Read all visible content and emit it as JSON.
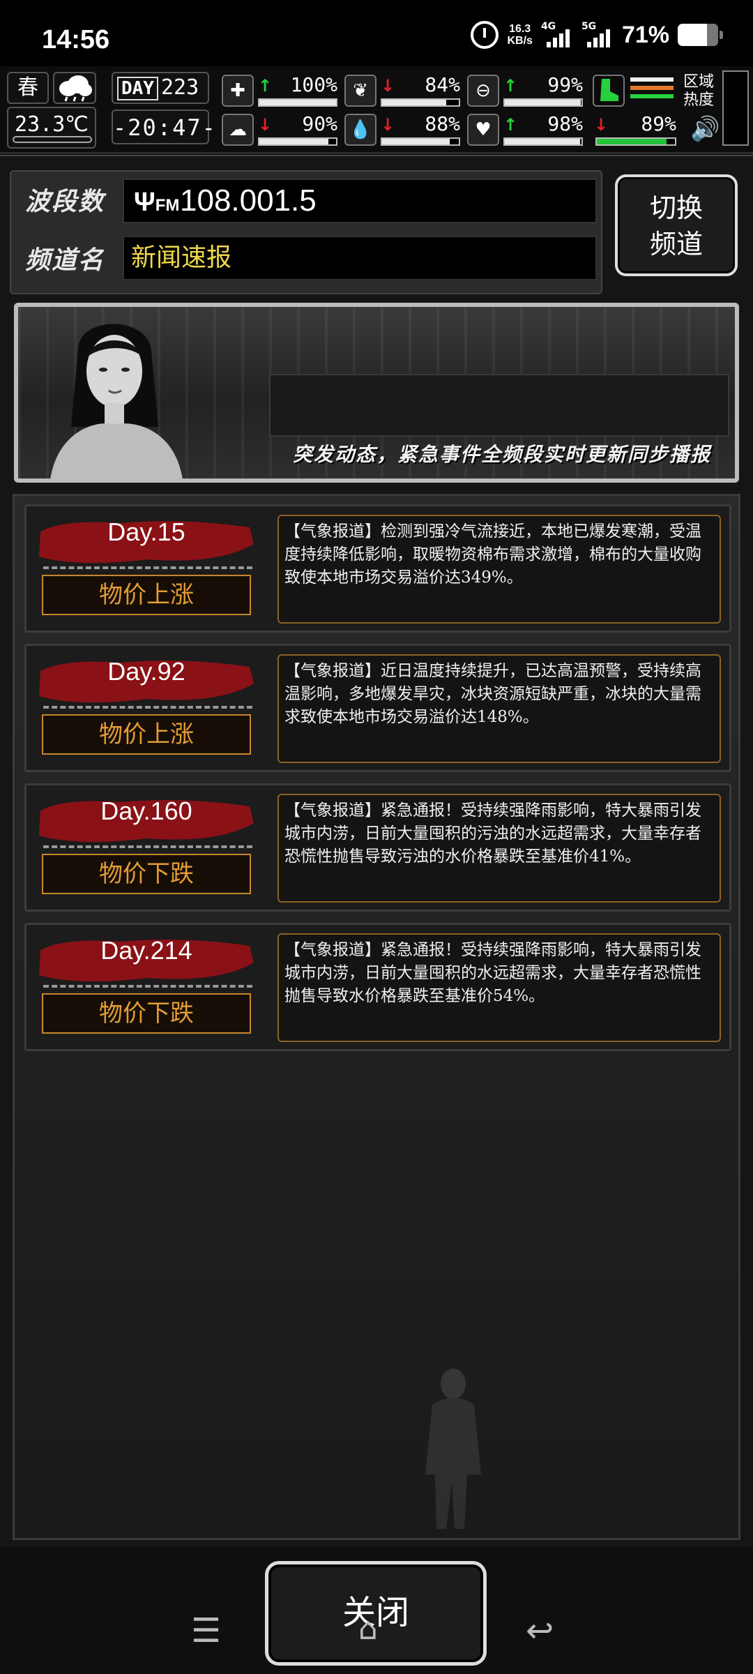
{
  "status_bar": {
    "time": "14:56",
    "net_speed": "16.3",
    "net_speed_unit": "KB/s",
    "net1": "4G",
    "net2": "5G",
    "battery": "71%"
  },
  "hud": {
    "season": "春",
    "temperature": "23.3℃",
    "day_label": "DAY",
    "day_number": "223",
    "clock": "-20:47-",
    "stats": [
      {
        "name": "health",
        "value": "100%",
        "trend": "up",
        "level": 1.0
      },
      {
        "name": "hunger",
        "value": "84%",
        "trend": "down",
        "level": 0.84
      },
      {
        "name": "thirst-gauge",
        "value": "99%",
        "trend": "up",
        "level": 0.99
      },
      {
        "name": "mood",
        "value": "90%",
        "trend": "down",
        "level": 0.9
      },
      {
        "name": "water",
        "value": "88%",
        "trend": "down",
        "level": 0.88
      },
      {
        "name": "heart",
        "value": "98%",
        "trend": "up",
        "level": 0.98
      },
      {
        "name": "stamina",
        "value": "89%",
        "trend": "down",
        "level": 0.89
      }
    ],
    "zone_label": "区域热度"
  },
  "radio": {
    "band_label": "波段数",
    "channel_label": "频道名",
    "frequency": "108.001.5",
    "channel_name": "新闻速报",
    "switch_button": "切换频道",
    "banner_caption": "突发动态，紧急事件全频段实时更新同步播报"
  },
  "news": [
    {
      "day": "Day.15",
      "tag": "物价上涨",
      "text": "【气象报道】检测到强冷气流接近，本地已爆发寒潮，受温度持续降低影响，取暖物资棉布需求激增，棉布的大量收购致使本地市场交易溢价达349%。"
    },
    {
      "day": "Day.92",
      "tag": "物价上涨",
      "text": "【气象报道】近日温度持续提升，已达高温预警，受持续高温影响，多地爆发旱灾，冰块资源短缺严重，冰块的大量需求致使本地市场交易溢价达148%。"
    },
    {
      "day": "Day.160",
      "tag": "物价下跌",
      "text": "【气象报道】紧急通报！受持续强降雨影响，特大暴雨引发城市内涝，日前大量囤积的污浊的水远超需求，大量幸存者恐慌性抛售导致污浊的水价格暴跌至基准价41%。"
    },
    {
      "day": "Day.214",
      "tag": "物价下跌",
      "text": "【气象报道】紧急通报！受持续强降雨影响，特大暴雨引发城市内涝，日前大量囤积的水远超需求，大量幸存者恐慌性抛售导致水价格暴跌至基准价54%。"
    }
  ],
  "bottom": {
    "close_button": "关闭"
  }
}
